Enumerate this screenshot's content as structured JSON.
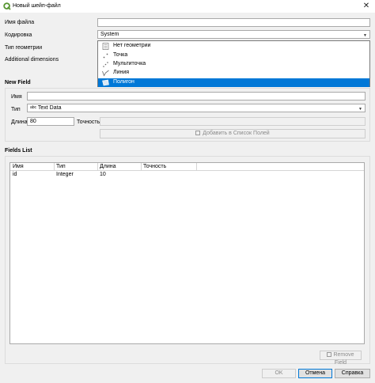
{
  "window": {
    "title": "Новый шейп-файл",
    "close_glyph": "✕"
  },
  "labels": {
    "filename": "Имя файла",
    "encoding": "Кодировка",
    "geometry_type": "Тип геометрии",
    "additional_dimensions": "Additional dimensions"
  },
  "encoding": {
    "value": "System"
  },
  "geometry_dropdown": {
    "items": [
      {
        "label": "Нет геометрии",
        "icon": "no-geometry-icon"
      },
      {
        "label": "Точка",
        "icon": "point-icon"
      },
      {
        "label": "Мультиточка",
        "icon": "multipoint-icon"
      },
      {
        "label": "Линия",
        "icon": "line-icon"
      },
      {
        "label": "Полигон",
        "icon": "polygon-icon"
      }
    ],
    "selected": "Полигон"
  },
  "new_field": {
    "title": "New Field",
    "name_label": "Имя",
    "type_label": "Тип",
    "type_icon": "abc",
    "type_value": "Text Data",
    "length_label": "Длина",
    "length_value": "80",
    "precision_label": "Точность",
    "add_button": "Добавить в Список Полей"
  },
  "fields_list": {
    "title": "Fields List",
    "columns": [
      "Имя",
      "Тип",
      "Длина",
      "Точность"
    ],
    "rows": [
      {
        "name": "id",
        "type": "Integer",
        "length": "10",
        "precision": ""
      }
    ],
    "remove_button": "Remove Field"
  },
  "buttons": {
    "ok": "OK",
    "cancel": "Отмена",
    "help": "Справка"
  },
  "colors": {
    "selection": "#0078d7",
    "qgis_green": "#589632"
  }
}
